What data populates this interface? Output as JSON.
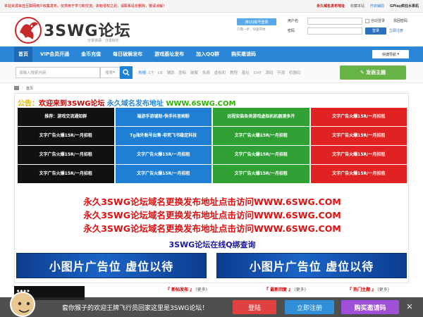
{
  "topbar": {
    "notice": "本站资源来自互联网用户收集发布，仅供用于学习和交流。如有侵权之处，请联系站长删除，敬请谅解！",
    "links": [
      "永久域名发布地址",
      "收藏本站",
      "GPlay疯狂水果机"
    ],
    "extra": "开启辅助"
  },
  "header": {
    "brand": "3SWG论坛",
    "slogan": "分享资源 · 分享快乐",
    "qq_button": "用QQ帐号登录",
    "qq_sub": "只需一步，快速开始"
  },
  "login": {
    "username_label": "用户名",
    "password_label": "密码",
    "auto_login": "自动登录",
    "forgot": "找回密码",
    "login_button": "登录",
    "register": "立即注册"
  },
  "nav": {
    "items": [
      "首页",
      "VIP会员开通",
      "金币充值",
      "每日破解发布",
      "游戏基址发布",
      "加入QQ群",
      "购买邀请码"
    ],
    "quick": "快捷导航"
  },
  "search": {
    "placeholder": "请输入搜索内容",
    "type": "搜索",
    "hot_label": "热搜:",
    "hot_words": [
      "CT",
      "CE",
      "辅助",
      "图标",
      "破解",
      "免费",
      "虚拟机",
      "教程",
      "基址",
      "DXF",
      "源码",
      "开源",
      "机器码"
    ],
    "post_button": "发表主题"
  },
  "breadcrumb": {
    "home": "首页"
  },
  "main": {
    "notice_parts": [
      "公告：",
      "欢迎来到3SWG论坛",
      " 永久域名发布地址",
      " WWW.6SWG.COM"
    ],
    "grid": [
      {
        "text": "推荐：游戏交流通知群",
        "color": "black"
      },
      {
        "text": "端游手游辅助-快手抖音刷粉",
        "color": "blue"
      },
      {
        "text": "远程安装各类游戏虚拟机机器测多开",
        "color": "green"
      },
      {
        "text": "文字广告火爆15R/一月招租",
        "color": "red"
      },
      {
        "text": "文字广告火爆15R/一月招租",
        "color": "black"
      },
      {
        "text": "Tg海外账号出售-非死飞书稳定科技",
        "color": "blue"
      },
      {
        "text": "文字广告火爆15R/一月招租",
        "color": "green"
      },
      {
        "text": "文字广告火爆15R/一月招租",
        "color": "red"
      },
      {
        "text": "文字广告火爆15R/一月招租",
        "color": "black"
      },
      {
        "text": "文字广告火爆15R/一月招租",
        "color": "blue"
      },
      {
        "text": "文字广告火爆15R/一月招租",
        "color": "green"
      },
      {
        "text": "文字广告火爆15R/一月招租",
        "color": "red"
      },
      {
        "text": "文字广告火爆15R/一月招租",
        "color": "black"
      },
      {
        "text": "文字广告火爆15R/一月招租",
        "color": "blue"
      },
      {
        "text": "文字广告火爆15R/一月招租",
        "color": "green"
      },
      {
        "text": "文字广告火爆15R/一月招租",
        "color": "red"
      }
    ],
    "red_links": [
      "永久3SWG论坛域名更换发布地址点击访问WWW.6SWG.COM",
      "永久3SWG论坛域名更换发布地址点击访问WWW.6SWG.COM",
      "永久3SWG论坛域名更换发布地址点击访问WWW.6SWG.COM"
    ],
    "qq_query": "3SWG论坛在线Q绑查询",
    "banners": [
      "小图片广告位 虚位以待",
      "小图片广告位 虚位以待"
    ]
  },
  "bottom_cols": {
    "c1": "『 新帖发布 』",
    "c2": "『 最新回复 』",
    "c3": "『 热门主题 』",
    "more": "(更多)"
  },
  "sticky": {
    "message": "套你猴子的欢迎王牌飞行员回家这里是3SWG论坛！",
    "login": "登陆",
    "register": "立即注册",
    "buy_code": "购买邀请码",
    "close": "✕"
  },
  "colors": {
    "nav": "#2b86d8",
    "post_button": "#67b346",
    "grid_black": "#111111",
    "grid_blue": "#1e7fd4",
    "grid_green": "#30a035",
    "grid_red": "#e02222"
  }
}
